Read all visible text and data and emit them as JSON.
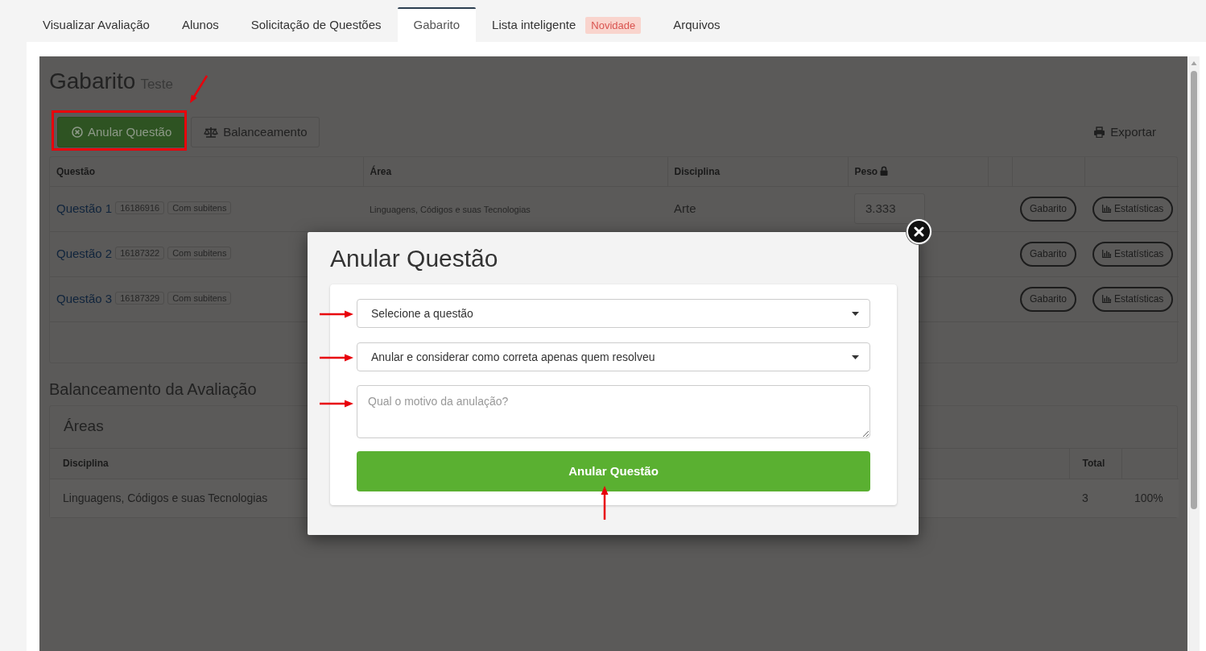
{
  "tabs": [
    {
      "label": "Visualizar Avaliação",
      "selected": false
    },
    {
      "label": "Alunos",
      "selected": false
    },
    {
      "label": "Solicitação de Questões",
      "selected": false
    },
    {
      "label": "Gabarito",
      "selected": true
    },
    {
      "label": "Lista inteligente",
      "selected": false,
      "badge": "Novidade"
    },
    {
      "label": "Arquivos",
      "selected": false
    }
  ],
  "page": {
    "title": "Gabarito",
    "subtitle": "Teste"
  },
  "toolbar": {
    "buttons": [
      {
        "label": "Anular Questão",
        "kind": "primary"
      },
      {
        "label": "Balanceamento",
        "kind": "outline"
      }
    ],
    "export": "Exportar"
  },
  "questions_table": {
    "columns": [
      "Questão",
      "Área",
      "Disciplina",
      "Peso"
    ],
    "rows": [
      {
        "question": "Questão 1",
        "code": "16186916",
        "tag": "Com subitens",
        "area": "Linguagens, Códigos e suas Tecnologias",
        "discipline": "Arte",
        "weight": "3.333",
        "actions": [
          {
            "label": "Gabarito",
            "kind": "plain"
          },
          {
            "label": "Estatísticas",
            "kind": "stats"
          }
        ]
      },
      {
        "question": "Questão 2",
        "code": "16187322",
        "tag": "Com subitens",
        "actions": [
          {
            "label": "Gabarito",
            "kind": "plain"
          },
          {
            "label": "Estatísticas",
            "kind": "stats"
          }
        ]
      },
      {
        "question": "Questão 3",
        "code": "16187329",
        "tag": "Com subitens",
        "actions": [
          {
            "label": "Gabarito",
            "kind": "plain"
          },
          {
            "label": "Estatísticas",
            "kind": "stats"
          }
        ]
      }
    ]
  },
  "balance": {
    "title": "Balanceamento da Avaliação",
    "card_title": "Áreas",
    "columns": [
      "Disciplina",
      "Total"
    ],
    "rows": [
      {
        "discipline": "Linguagens, Códigos e suas Tecnologias",
        "total": "3",
        "percent": "100%"
      }
    ]
  },
  "modal": {
    "title": "Anular Questão",
    "fields": [
      {
        "kind": "select",
        "value": "Selecione a questão"
      },
      {
        "kind": "select",
        "value": "Anular e considerar como correta apenas quem resolveu"
      },
      {
        "kind": "textarea",
        "placeholder": "Qual o motivo da anulação?"
      }
    ],
    "submit": "Anular Questão"
  }
}
